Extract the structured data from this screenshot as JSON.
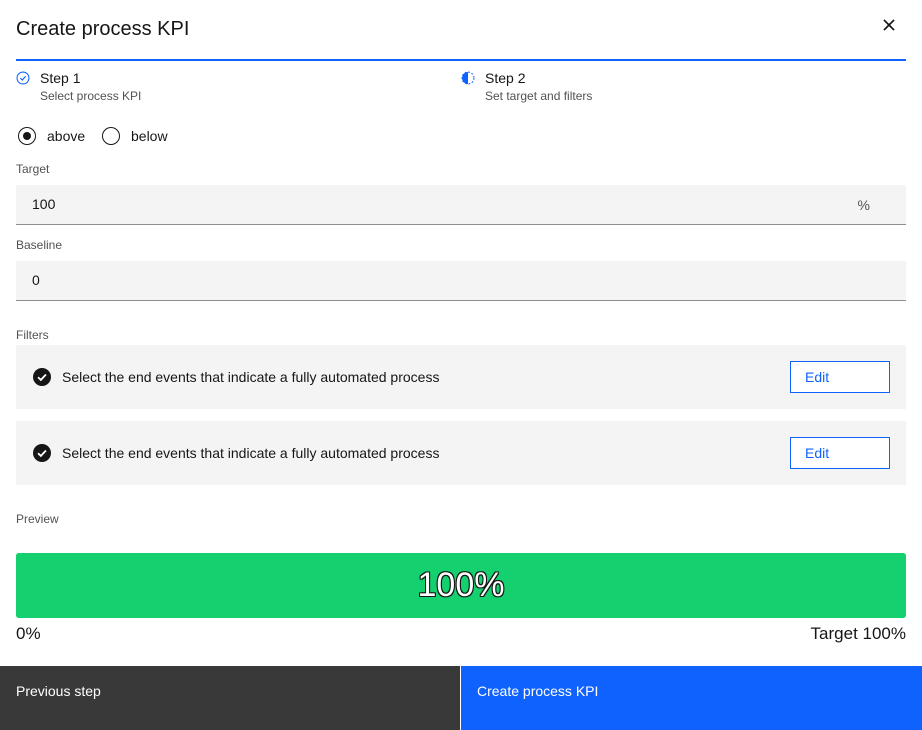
{
  "modal": {
    "title": "Create process KPI",
    "close_icon": "close-icon"
  },
  "steps": [
    {
      "label": "Step 1",
      "subtitle": "Select process KPI",
      "state": "complete",
      "icon": "checkmark-outline-icon"
    },
    {
      "label": "Step 2",
      "subtitle": "Set target and filters",
      "state": "current",
      "icon": "incomplete-icon"
    }
  ],
  "direction": {
    "options": [
      {
        "label": "above",
        "checked": true
      },
      {
        "label": "below",
        "checked": false
      }
    ]
  },
  "target": {
    "label": "Target",
    "value": "100",
    "suffix": "%"
  },
  "baseline": {
    "label": "Baseline",
    "value": "0"
  },
  "filters": {
    "label": "Filters",
    "items": [
      {
        "text": "Select the end events that indicate a fully automated process",
        "edit_label": "Edit",
        "icon": "checkmark-filled-icon"
      },
      {
        "text": "Select the end events that indicate a fully automated process",
        "edit_label": "Edit",
        "icon": "checkmark-filled-icon"
      }
    ]
  },
  "preview": {
    "label": "Preview",
    "value_text": "100%",
    "progress": 1.0,
    "min_label": "0%",
    "max_label": "Target 100%",
    "bar_color": "#15d06e"
  },
  "footer": {
    "secondary_label": "Previous step",
    "primary_label": "Create process KPI"
  },
  "colors": {
    "accent": "#0f62fe",
    "success": "#15d06e",
    "secondary_button": "#393939",
    "field_bg": "#f4f4f4"
  }
}
